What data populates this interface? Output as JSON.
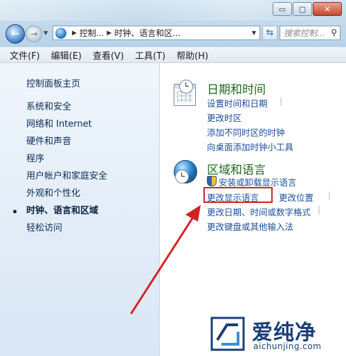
{
  "window": {
    "buttons": {
      "minimize": "▭",
      "maximize": "▢",
      "close": "✕"
    }
  },
  "nav": {
    "address": {
      "part1": "控制...",
      "part2": "时钟、语言和区..."
    },
    "search_placeholder": "搜索控制...",
    "search_icon": "search-icon"
  },
  "menu": {
    "items": [
      "文件(F)",
      "编辑(E)",
      "查看(V)",
      "工具(T)",
      "帮助(H)"
    ]
  },
  "sidebar": {
    "home": "控制面板主页",
    "items": [
      "系统和安全",
      "网络和 Internet",
      "硬件和声音",
      "程序",
      "用户帐户和家庭安全",
      "外观和个性化",
      "时钟、语言和区域",
      "轻松访问"
    ],
    "active_index": 6
  },
  "datetime": {
    "title": "日期和时间",
    "links": [
      "设置时间和日期",
      "更改时区",
      "添加不同时区的时钟",
      "向桌面添加时钟小工具"
    ]
  },
  "region": {
    "title": "区域和语言",
    "install_link": "安装或卸载显示语言",
    "change_display_language": "更改显示语言",
    "change_location": "更改位置",
    "change_formats": "更改日期、时间或数字格式",
    "change_keyboards": "更改键盘或其他输入法"
  },
  "annotation": {
    "color": "#d42222"
  },
  "watermark": {
    "brand": "爱纯净",
    "url": "aichunjing.com"
  },
  "colors": {
    "link": "#1b4e9b",
    "category_title": "#1f6a1f",
    "sidebar_text": "#0b2a55"
  }
}
